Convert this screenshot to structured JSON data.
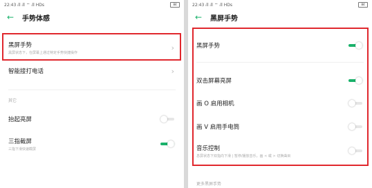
{
  "left": {
    "status": {
      "time": "22:43",
      "signals": "ᵢll ᵢll ⌔ ᵢll HDs",
      "battery": "84"
    },
    "title": "手势体感",
    "items": [
      {
        "title": "黑屏手势",
        "subtitle": "黑屏状态下，在屏幕上通过特定手势快捷操作"
      },
      {
        "title": "智能接打电话",
        "subtitle": ""
      }
    ],
    "section_label": "其它",
    "toggle_items": [
      {
        "title": "抬起亮屏",
        "subtitle": "",
        "state": "off"
      },
      {
        "title": "三指截屏",
        "subtitle": "三指下滑快速截屏",
        "state": "on"
      }
    ]
  },
  "right": {
    "status": {
      "time": "22:43",
      "signals": "ᵢll ᵢll ⌔ ᵢll HDs",
      "battery": "84"
    },
    "title": "黑屏手势",
    "items": [
      {
        "title": "黑屏手势",
        "subtitle": "",
        "state": "on"
      },
      {
        "title": "双击屏幕亮屏",
        "subtitle": "",
        "state": "on"
      },
      {
        "title": "画 O 启用相机",
        "subtitle": "",
        "state": "off"
      },
      {
        "title": "画 V 启用手电筒",
        "subtitle": "",
        "state": "off"
      },
      {
        "title": "音乐控制",
        "subtitle": "息屏状态下双指向下滑 | 暂停/播放音乐，画 < 或 > 切换曲目",
        "state": "off"
      }
    ],
    "footer_label": "更多黑屏手势"
  },
  "colors": {
    "accent": "#1ab26b",
    "highlight": "#e0262c"
  }
}
